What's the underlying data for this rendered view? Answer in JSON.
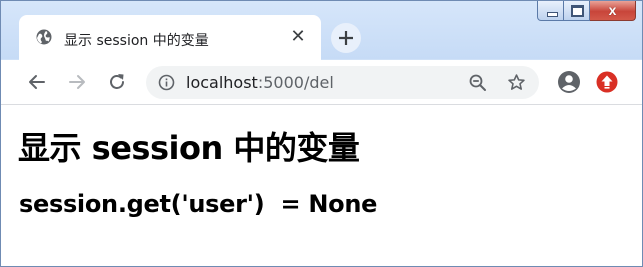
{
  "tab": {
    "title": "显示 session 中的变量",
    "close_glyph": "✕",
    "favicon": "globe-icon"
  },
  "toolbar": {
    "back_icon": "arrow-left-icon",
    "forward_icon": "arrow-right-icon",
    "reload_icon": "reload-icon",
    "url_host": "localhost",
    "url_path": ":5000/del",
    "zoom_icon": "zoom-out-icon",
    "bookmark_icon": "star-icon",
    "profile_icon": "account-icon",
    "extension_icon": "extension-icon"
  },
  "window_controls": {
    "close_glyph": "x"
  },
  "page": {
    "heading": "显示 session 中的变量",
    "session_line": "session.get('user')  = None"
  },
  "colors": {
    "frame": "#cfe1f7",
    "close_button": "#c8453a",
    "extension_red": "#d93025",
    "icon_gray": "#5f6368"
  }
}
